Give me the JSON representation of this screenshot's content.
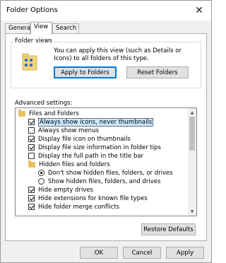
{
  "window": {
    "title": "Folder Options"
  },
  "tabs": [
    {
      "label": "General"
    },
    {
      "label": "View"
    },
    {
      "label": "Search"
    }
  ],
  "folder_views": {
    "group_label": "Folder views",
    "description": "You can apply this view (such as Details or Icons) to all folders of this type.",
    "apply_button": "Apply to Folders",
    "reset_button": "Reset Folders"
  },
  "advanced": {
    "label": "Advanced settings:",
    "items": [
      {
        "type": "folder",
        "label": "Files and Folders"
      },
      {
        "type": "checkbox",
        "checked": true,
        "label": "Always show icons, never thumbnails",
        "selected": true
      },
      {
        "type": "checkbox",
        "checked": false,
        "label": "Always show menus"
      },
      {
        "type": "checkbox",
        "checked": true,
        "label": "Display file icon on thumbnails"
      },
      {
        "type": "checkbox",
        "checked": true,
        "label": "Display file size information in folder tips"
      },
      {
        "type": "checkbox",
        "checked": false,
        "label": "Display the full path in the title bar"
      },
      {
        "type": "folder",
        "label": "Hidden files and folders"
      },
      {
        "type": "radio",
        "checked": true,
        "label": "Don't show hidden files, folders, or drives"
      },
      {
        "type": "radio",
        "checked": false,
        "label": "Show hidden files, folders, and drives"
      },
      {
        "type": "checkbox",
        "checked": true,
        "label": "Hide empty drives"
      },
      {
        "type": "checkbox",
        "checked": true,
        "label": "Hide extensions for known file types"
      },
      {
        "type": "checkbox",
        "checked": true,
        "label": "Hide folder merge conflicts"
      }
    ],
    "restore_button": "Restore Defaults"
  },
  "footer": {
    "ok": "OK",
    "cancel": "Cancel",
    "apply": "Apply"
  },
  "colors": {
    "selection": "#cce8ff",
    "focus": "#0078d7",
    "folder": "#e8c25d"
  }
}
